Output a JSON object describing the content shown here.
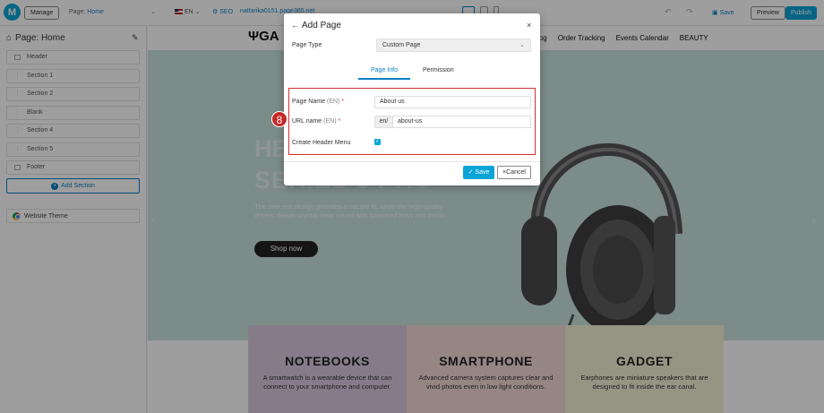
{
  "topbar": {
    "logo_letter": "M",
    "manage_label": "Manage",
    "page_prefix": "Page:",
    "page_name": "Home",
    "lang": "EN",
    "seo_label": "SEO",
    "domain": "nattarika0151.page365.net",
    "save_label": "Save",
    "preview_label": "Preview",
    "publish_label": "Publish"
  },
  "sidebar": {
    "title": "Page: Home",
    "items": [
      {
        "label": "Header"
      },
      {
        "label": "Section 1"
      },
      {
        "label": "Section 2"
      },
      {
        "label": "Blank"
      },
      {
        "label": "Section 4"
      },
      {
        "label": "Section 5"
      },
      {
        "label": "Footer"
      }
    ],
    "add_section_label": "Add Section",
    "website_theme_label": "Website Theme"
  },
  "site": {
    "logo": "GA",
    "nav": [
      "log",
      "Order Tracking",
      "Events Calendar",
      "BEAUTY"
    ],
    "hero_title_1": "HE",
    "hero_title_2": "SERIES 3 PRO",
    "hero_desc": "The over-ear design provides a secure fit, while the high-quality drivers deliver crystal clear sound with balanced bass and treble.",
    "shop_label": "Shop now",
    "categories": [
      {
        "title": "NOTEBOOKS",
        "desc": "A smartwatch is a wearable device that can connect to your smartphone and computer.",
        "color": "#d9c8dd"
      },
      {
        "title": "SMARTPHONE",
        "desc": "Advanced camera system captures clear and vivid photos even in low light conditions.",
        "color": "#f1d9d6"
      },
      {
        "title": "GADGET",
        "desc": "Earphones are miniature speakers that are designed to fit inside the ear canal.",
        "color": "#f3f0d5"
      }
    ]
  },
  "modal": {
    "title": "Add Page",
    "page_type_label": "Page Type",
    "page_type_value": "Custom Page",
    "tabs": [
      "Page Info",
      "Permission"
    ],
    "page_name_label": "Page Name",
    "page_name_lang": "(EN)",
    "page_name_value": "About us",
    "url_label": "URL name",
    "url_lang": "(EN)",
    "url_prefix": "en/",
    "url_value": "about-us",
    "header_menu_label": "Create Header Menu",
    "save_label": "Save",
    "cancel_label": "Cancel",
    "required_mark": "*"
  },
  "annotation": {
    "step": "8"
  }
}
